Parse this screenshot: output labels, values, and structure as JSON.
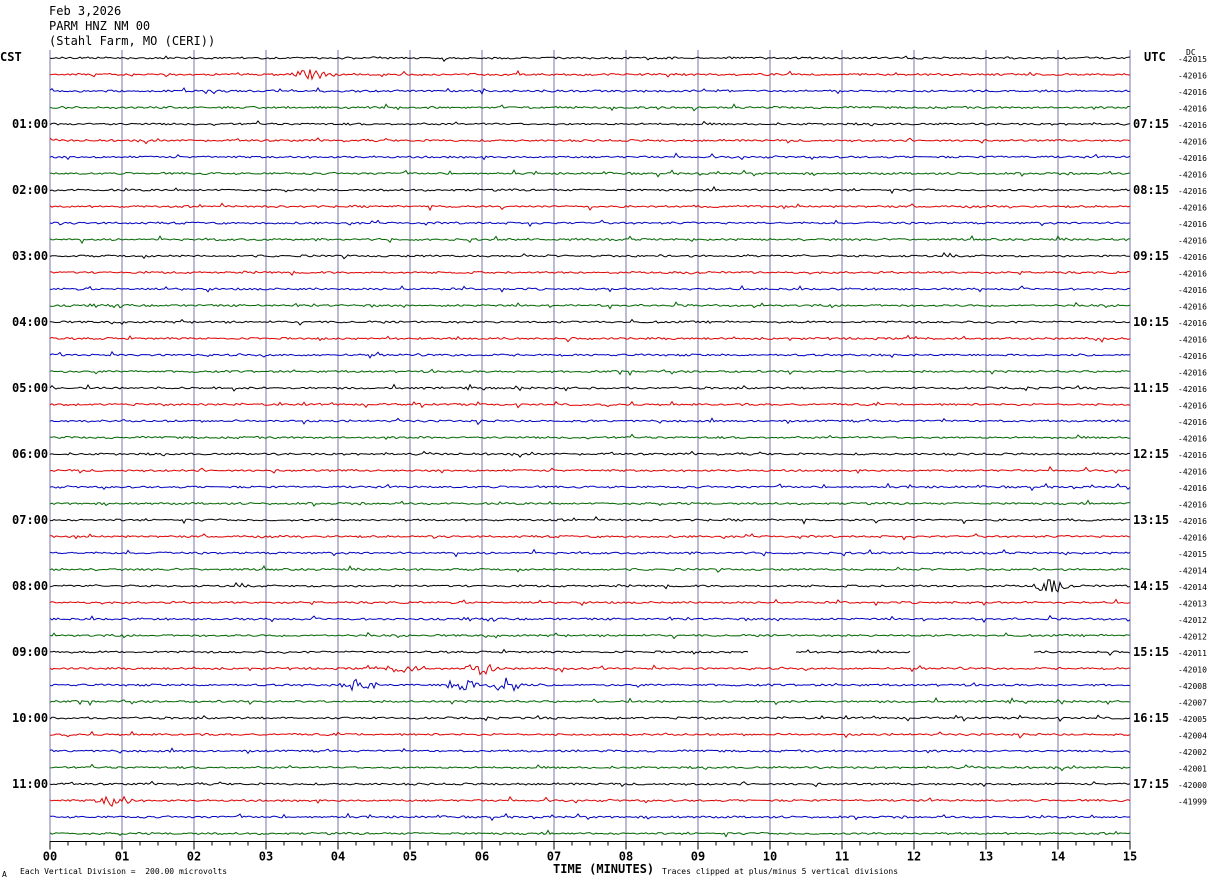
{
  "header": {
    "date": "Feb 3,2026",
    "station": "PARM HNZ NM 00",
    "location": "(Stahl Farm, MO (CERI))"
  },
  "left_timezone": "CST",
  "right_timezone": "UTC",
  "dc_label": "DC",
  "footer": {
    "scale_note": "Each Vertical Division =  200.00 microvolts",
    "clip_note": "Traces clipped at plus/minus 5 vertical divisions",
    "corner_mark": "A"
  },
  "colors": {
    "trace_cycle": [
      "#000000",
      "#e00000",
      "#0000c0",
      "#006600"
    ],
    "grid": "#7777aa"
  },
  "chart_data": {
    "type": "line",
    "title": "PARM HNZ NM 00",
    "xlabel": "TIME (MINUTES)",
    "x_ticks": [
      "00",
      "01",
      "02",
      "03",
      "04",
      "05",
      "06",
      "07",
      "08",
      "09",
      "10",
      "11",
      "12",
      "13",
      "14",
      "15"
    ],
    "xlim": [
      0,
      15
    ],
    "left_hour_labels": [
      "01:00",
      "02:00",
      "03:00",
      "04:00",
      "05:00",
      "06:00",
      "07:00",
      "08:00",
      "09:00",
      "10:00",
      "11:00"
    ],
    "right_hour_labels": [
      "07:15",
      "08:15",
      "09:15",
      "10:15",
      "11:15",
      "12:15",
      "13:15",
      "14:15",
      "15:15",
      "16:15",
      "17:15"
    ],
    "trace_count": 48,
    "dc_offsets": [
      "-42015",
      "-42016",
      "-42016",
      "-42016",
      "-42016",
      "-42016",
      "-42016",
      "-42016",
      "-42016",
      "-42016",
      "-42016",
      "-42016",
      "-42016",
      "-42016",
      "-42016",
      "-42016",
      "-42016",
      "-42016",
      "-42016",
      "-42016",
      "-42016",
      "-42016",
      "-42016",
      "-42016",
      "-42016",
      "-42016",
      "-42016",
      "-42016",
      "-42016",
      "-42016",
      "-42015",
      "-42014",
      "-42014",
      "-42013",
      "-42012",
      "-42012",
      "-42011",
      "-42010",
      "-42008",
      "-42007",
      "-42005",
      "-42004",
      "-42002",
      "-42001",
      "-42000",
      "-41999"
    ],
    "gaps_minutes": [
      {
        "trace": 36,
        "from": 9.7,
        "to": 10.35
      },
      {
        "trace": 36,
        "from": 11.95,
        "to": 13.65
      }
    ],
    "events": [
      {
        "trace": 1,
        "at_minute": 3.6,
        "amplitude": 2
      },
      {
        "trace": 37,
        "at_minute": 4.9,
        "amplitude": 1.5
      },
      {
        "trace": 37,
        "at_minute": 6.0,
        "amplitude": 2
      },
      {
        "trace": 38,
        "at_minute": 4.3,
        "amplitude": 2
      },
      {
        "trace": 38,
        "at_minute": 5.7,
        "amplitude": 2.5
      },
      {
        "trace": 38,
        "at_minute": 6.35,
        "amplitude": 2.5
      },
      {
        "trace": 32,
        "at_minute": 13.9,
        "amplitude": 2.5
      },
      {
        "trace": 45,
        "at_minute": 0.9,
        "amplitude": 2
      }
    ]
  }
}
